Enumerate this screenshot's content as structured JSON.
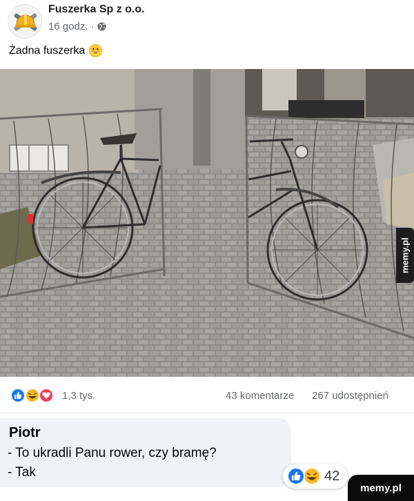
{
  "post": {
    "page_name": "Fuszerka Sp z o.o.",
    "time": "16 godz.",
    "separator": "·",
    "text": "Żadna fuszerka"
  },
  "icons": {
    "avatar": "hammer-wrench-helmet-logo",
    "privacy": "globe-icon",
    "emoji": "grinning-face-emoji",
    "reactions": [
      "like-icon",
      "haha-icon",
      "love-icon"
    ],
    "comment_reactions": [
      "like-icon",
      "haha-icon"
    ]
  },
  "stats": {
    "reactions": "1,3 tys.",
    "comments": "43 komentarze",
    "shares": "267 udostępnień"
  },
  "comment": {
    "author": "Piotr",
    "line1": "- To ukradli Panu rower, czy bramę?",
    "line2": "- Tak",
    "reaction_count": "42"
  },
  "watermarks": {
    "side": "memy.pl",
    "corner": "memy.pl"
  },
  "colors": {
    "like_blue": "#1877f2",
    "haha_yellow": "#f7b928",
    "love_red": "#f33e58",
    "meta_gray": "#65676b",
    "comment_bg": "#f0f2f5"
  }
}
